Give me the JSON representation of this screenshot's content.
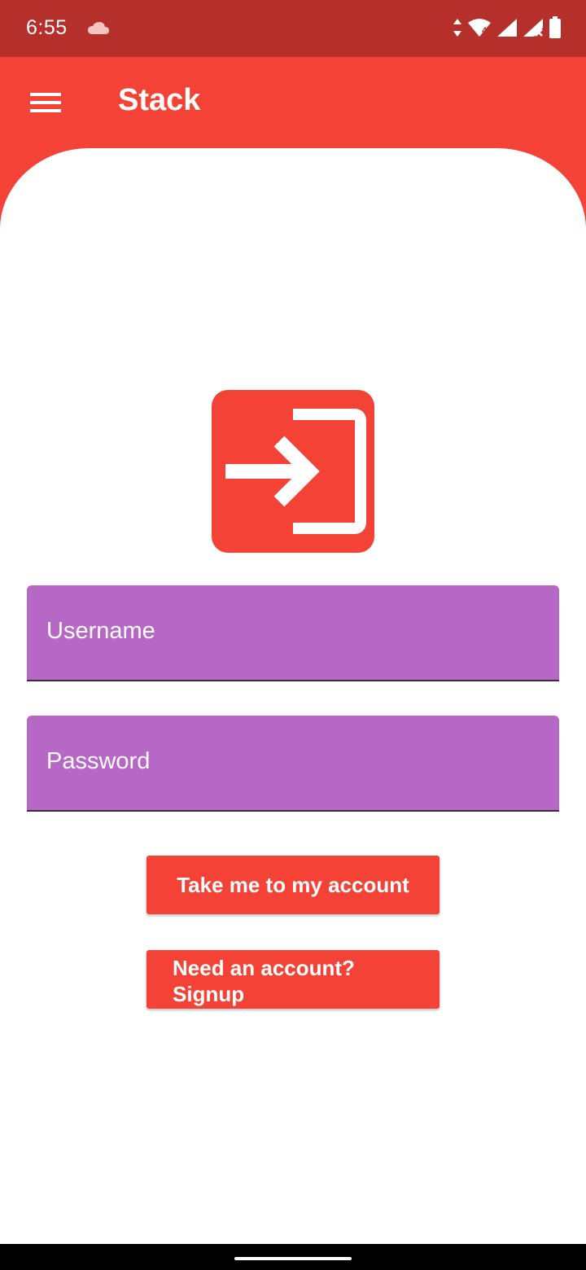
{
  "status_bar": {
    "time": "6:55",
    "icons": [
      "cloud-icon",
      "data-arrows-icon",
      "wifi-icon",
      "signal-icon",
      "signal-no-service-icon",
      "battery-icon"
    ],
    "wifi_badge": "4"
  },
  "app_bar": {
    "title": "Stack",
    "menu_icon": "hamburger-menu-icon"
  },
  "login": {
    "icon": "login-arrow-icon",
    "username_placeholder": "Username",
    "password_placeholder": "Password",
    "primary_button": "Take me to my account",
    "secondary_button": "Need an account? Signup"
  },
  "colors": {
    "status_bar": "#b5302a",
    "primary": "#f44336",
    "field": "#b768c6",
    "text_on_primary": "#ffffff"
  }
}
